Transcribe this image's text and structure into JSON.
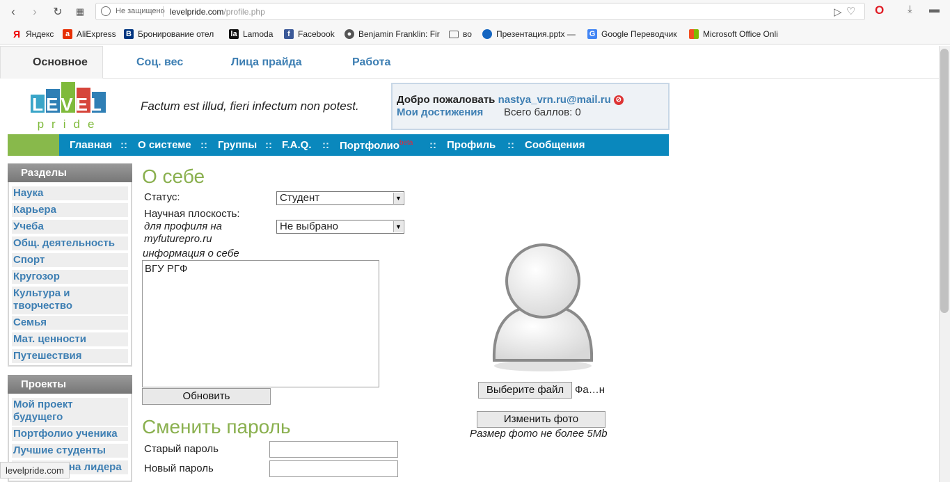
{
  "browser": {
    "security": "Не защищено",
    "host": "levelpride.com",
    "path": "/profile.php"
  },
  "bookmarks": [
    {
      "label": "Яндекс",
      "icon": "yandex-icon"
    },
    {
      "label": "AliExpress",
      "icon": "aliexpress-icon"
    },
    {
      "label": "Бронирование отел",
      "icon": "booking-icon"
    },
    {
      "label": "Lamoda",
      "icon": "lamoda-icon"
    },
    {
      "label": "Facebook",
      "icon": "facebook-icon"
    },
    {
      "label": "Benjamin Franklin: Fir",
      "icon": "seal-icon"
    },
    {
      "label": "во",
      "icon": "folder-icon"
    },
    {
      "label": "Презентация.pptx —",
      "icon": "onedrive-icon"
    },
    {
      "label": "Google Переводчик",
      "icon": "translate-icon"
    },
    {
      "label": "Microsoft Office Onli",
      "icon": "office-icon"
    }
  ],
  "tabs": [
    {
      "label": "Основное",
      "active": true
    },
    {
      "label": "Соц. вес",
      "active": false
    },
    {
      "label": "Лица прайда",
      "active": false
    },
    {
      "label": "Работа",
      "active": false
    }
  ],
  "header": {
    "logo_top": "LEVEL",
    "logo_bottom": "pride",
    "motto": "Factum est illud, fieri infectum non potest.",
    "welcome_label": "Добро пожаловать",
    "email": "nastya_vrn.ru@mail.ru",
    "achievements": "Мои достижения",
    "score": "Всего баллов: 0"
  },
  "menu": {
    "items": [
      "Главная",
      "О системе",
      "Группы",
      "F.A.Q.",
      "Портфолио",
      "Профиль",
      "Сообщения"
    ],
    "beta": "beta",
    "separator": "::"
  },
  "sidebar": {
    "sections_title": "Разделы",
    "sections": [
      "Наука",
      "Карьера",
      "Учеба",
      "Общ. деятельность",
      "Спорт",
      "Кругозор",
      "Культура и творчество",
      "Семья",
      "Мат. ценности",
      "Путешествия"
    ],
    "projects_title": "Проекты",
    "projects": [
      "Мой проект будущего",
      "Портфолио ученика",
      "Лучшие студенты",
      "на лидера"
    ]
  },
  "about": {
    "title": "О себе",
    "status_label": "Статус:",
    "status_value": "Студент",
    "science_label": "Научная плоскость:",
    "science_hint": "для профиля на myfuturepro.ru",
    "science_value": "Не выбрано",
    "info_label": "информация о себе",
    "info_text": "ВГУ РГФ",
    "update_button": "Обновить"
  },
  "photo": {
    "choose_button": "Выберите файл",
    "file_name": "Фа…н",
    "change_button": "Изменить фото",
    "size_note": "Размер фото не более 5Mb"
  },
  "password": {
    "title": "Сменить пароль",
    "old_label": "Старый пароль",
    "new_label": "Новый пароль"
  },
  "status_tip": "levelpride.com"
}
